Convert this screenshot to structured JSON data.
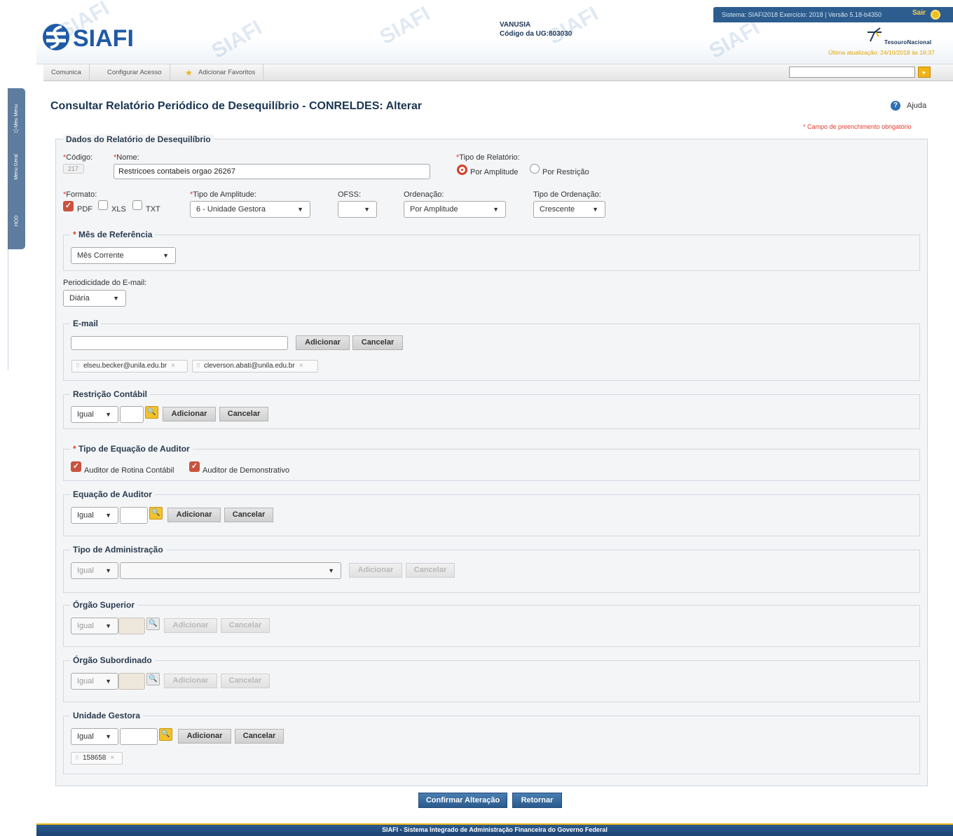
{
  "header": {
    "system_info": "Sistema: SIAFI2018 Exercício: 2018 | Versão 5.18-b4350",
    "logout_label": "Sair",
    "logo_text": "SIAFI",
    "user_name": "VANUSIA",
    "ug_code": "Código da UG:803030",
    "brand": "TesouroNacional",
    "last_update": "Última atualização: 24/10/2018 às 16:37"
  },
  "menu": {
    "items": [
      "Comunica",
      "Configurar Acesso",
      "Adicionar Favoritos"
    ]
  },
  "side_tabs": [
    "Meu Menu",
    "Menu Geral",
    "HOD"
  ],
  "page": {
    "title": "Consultar Relatório Periódico de Desequilíbrio - CONRELDES: Alterar",
    "help": "Ajuda",
    "required_note": "* Campo de preenchimento obrigatório"
  },
  "form": {
    "legend": "Dados do Relatório de Desequilíbrio",
    "codigo_label": "Código:",
    "codigo_value": "217",
    "nome_label": "Nome:",
    "nome_value": "Restricoes contabeis orgao 26267",
    "tipo_relatorio_label": "Tipo de Relatório:",
    "tipo_relatorio_opts": [
      "Por Amplitude",
      "Por Restrição"
    ],
    "formato_label": "Formato:",
    "formato_opts": [
      "PDF",
      "XLS",
      "TXT"
    ],
    "tipo_amplitude_label": "Tipo de Amplitude:",
    "tipo_amplitude_value": "6 - Unidade Gestora",
    "ofss_label": "OFSS:",
    "ofss_value": "",
    "ordenacao_label": "Ordenação:",
    "ordenacao_value": "Por Amplitude",
    "tipo_ordenacao_label": "Tipo de Ordenação:",
    "tipo_ordenacao_value": "Crescente",
    "mes_ref_label": "Mês de Referência",
    "mes_ref_value": "Mês Corrente",
    "periodicidade_label": "Periodicidade do E-mail:",
    "periodicidade_value": "Diária",
    "email_legend": "E-mail",
    "email_input": "",
    "emails": [
      "elseu.becker@unila.edu.br",
      "cleverson.abati@unila.edu.br"
    ],
    "restricao_legend": "Restrição Contábil",
    "tipo_equacao_legend": "Tipo de Equação de Auditor",
    "tipo_equacao_opts": [
      "Auditor de Rotina Contábil",
      "Auditor de Demonstrativo"
    ],
    "equacao_legend": "Equação de Auditor",
    "tipo_admin_legend": "Tipo de Administração",
    "orgao_superior_legend": "Órgão Superior",
    "orgao_subordinado_legend": "Órgão Subordinado",
    "unidade_gestora_legend": "Unidade Gestora",
    "ug_tags": [
      "158658"
    ],
    "operator_value": "Igual",
    "add_label": "Adicionar",
    "cancel_label": "Cancelar"
  },
  "actions": {
    "confirm": "Confirmar Alteração",
    "back": "Retornar"
  },
  "footer": "SIAFI - Sistema Integrado de Administração Financeira do Governo Federal",
  "colors": {
    "brand_blue": "#2d5d8f",
    "accent_orange": "#f0b418",
    "required_red": "#e03a2a"
  }
}
